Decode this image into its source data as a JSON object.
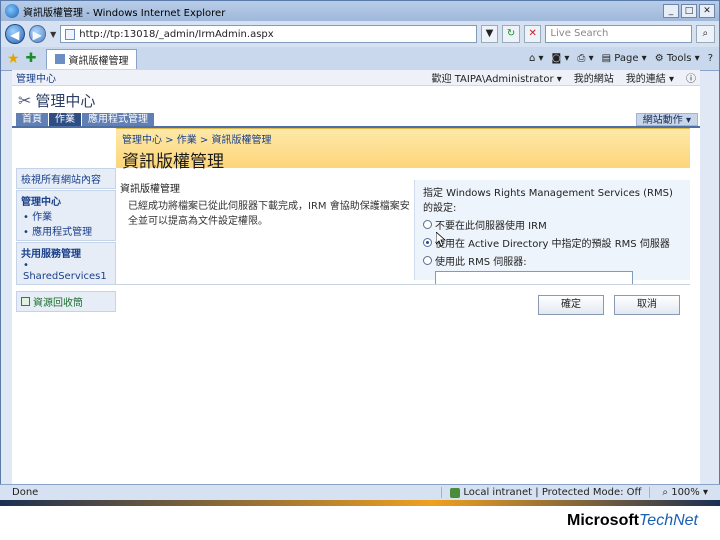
{
  "window": {
    "title": "資訊版權管理 - Windows Internet Explorer",
    "address": "http://tp:13018/_admin/IrmAdmin.aspx",
    "search_placeholder": "Live Search",
    "tab_label": "資訊版權管理",
    "page_menu": "Page",
    "tools_menu": "Tools"
  },
  "sharepoint": {
    "topbar_site": "管理中心",
    "welcome": "歡迎 TAIPA\\Administrator ▾",
    "my_site": "我的網站",
    "my_links": "我的連結 ▾",
    "site_title": "管理中心",
    "nav_tabs": [
      "首頁",
      "作業",
      "應用程式管理"
    ],
    "site_actions": "網站動作 ▾"
  },
  "leftnav": {
    "view_all": "檢視所有網站內容",
    "central_admin": "管理中心",
    "operations": "作業",
    "app_management": "應用程式管理",
    "shared_services_head": "共用服務管理",
    "shared_services_item": "SharedServices1",
    "recycle_bin": "資源回收筒"
  },
  "page": {
    "breadcrumb": "管理中心 > 作業 > 資訊版權管理",
    "title": "資訊版權管理",
    "section_title": "資訊版權管理",
    "section_desc": "已經成功將檔案已從此伺服器下載完成，IRM 會協助保護檔案安全並可以提高為文件設定權限。",
    "prompt": "指定 Windows Rights Management Services (RMS) 的設定:",
    "option_none": "不要在此伺服器使用 IRM",
    "option_ad": "使用在 Active Directory 中指定的預設 RMS 伺服器",
    "option_specific": "使用此 RMS 伺服器:",
    "rms_server_value": "",
    "ok_button": "確定",
    "cancel_button": "取消"
  },
  "statusbar": {
    "status": "Done",
    "zone": "Local intranet | Protected Mode: Off",
    "zoom": "100% ▾"
  },
  "footer": {
    "brand_ms": "Microsoft",
    "brand_tn": "TechNet"
  }
}
